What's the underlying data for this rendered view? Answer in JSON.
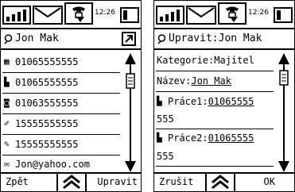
{
  "status": {
    "time": "12:26"
  },
  "screen1": {
    "title": "Jon Mak",
    "items": [
      {
        "icon": "home-phone-icon",
        "text": "01065555555"
      },
      {
        "icon": "work-phone-icon",
        "text": "01065555555"
      },
      {
        "icon": "fax-icon",
        "text": "01063555555"
      },
      {
        "icon": "mobile-phone-icon",
        "text": "15555555555"
      },
      {
        "icon": "mobile-phone-2-icon",
        "text": "15555555555"
      },
      {
        "icon": "email-icon",
        "text": "Jon@yahoo.com"
      }
    ],
    "left_button": "Zpět",
    "right_button": "Upravit"
  },
  "screen2": {
    "title": "Upravit:Jon Mak",
    "category_label": "Kategorie:",
    "category_value": "Majitel",
    "name_label": "Název:",
    "name_value": "Jon Mak",
    "work1_label": "Práce1:",
    "work1_value_a": "01065555",
    "work1_value_b": "555",
    "work2_label": "Práce2:",
    "work2_value_a": "01065555",
    "work2_value_b": "555",
    "left_button": "Zrušit",
    "right_button": "OK"
  }
}
